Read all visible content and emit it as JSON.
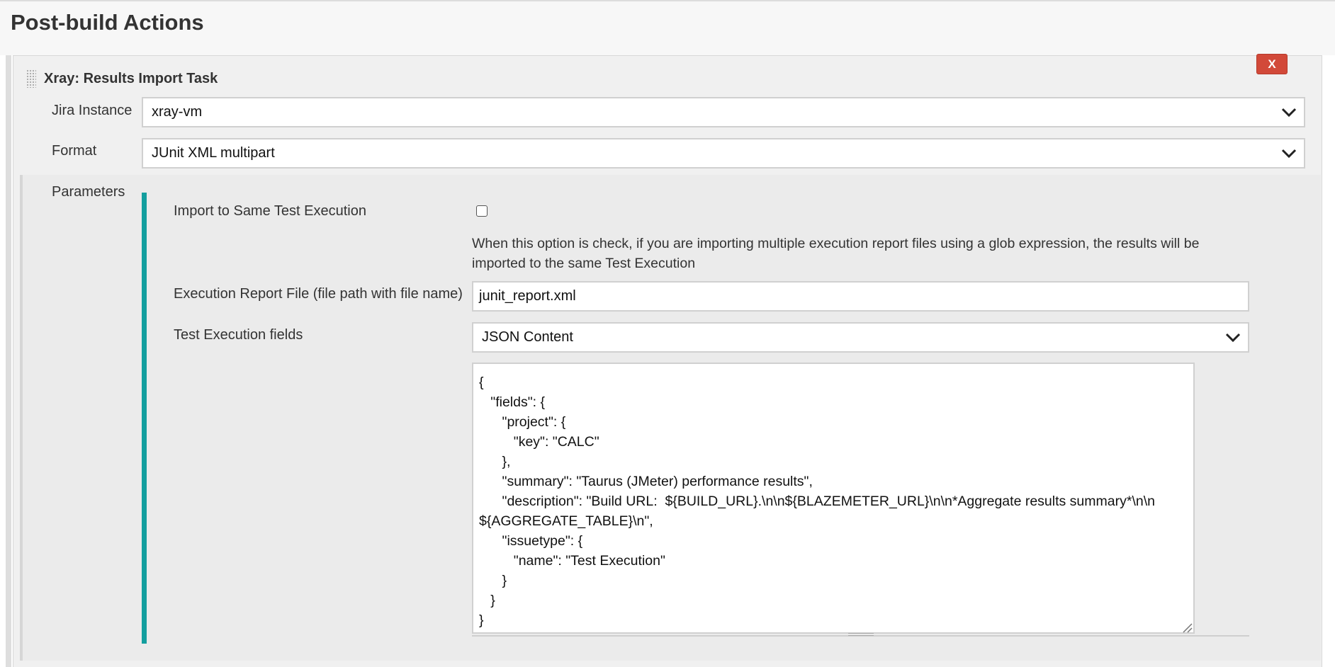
{
  "section": {
    "title": "Post-build Actions"
  },
  "task": {
    "title": "Xray: Results Import Task",
    "delete_label": "X"
  },
  "fields": {
    "jira_instance": {
      "label": "Jira Instance",
      "value": "xray-vm"
    },
    "format": {
      "label": "Format",
      "value": "JUnit XML multipart"
    }
  },
  "parameters": {
    "label": "Parameters",
    "import_same_execution": {
      "label": "Import to Same Test Execution",
      "checked": false,
      "help": "When this option is check, if you are importing multiple execution report files using a glob expression, the results will be imported to the same Test Execution"
    },
    "report_file": {
      "label": "Execution Report File (file path with file name)",
      "value": "junit_report.xml"
    },
    "test_execution_fields": {
      "label": "Test Execution fields",
      "value": "JSON Content",
      "content": "{\n   \"fields\": {\n      \"project\": {\n         \"key\": \"CALC\"\n      },\n      \"summary\": \"Taurus (JMeter) performance results\",\n      \"description\": \"Build URL:  ${BUILD_URL}.\\n\\n${BLAZEMETER_URL}\\n\\n*Aggregate results summary*\\n\\n ${AGGREGATE_TABLE}\\n\",\n      \"issuetype\": {\n         \"name\": \"Test Execution\"\n      }\n   }\n}"
    }
  },
  "icons": {
    "drag": "drag-handle-icon",
    "chevron": "chevron-down-icon",
    "resize": "resize-grip-icon"
  },
  "colors": {
    "accent_bar": "#139e9e",
    "delete_button": "#d24939"
  }
}
